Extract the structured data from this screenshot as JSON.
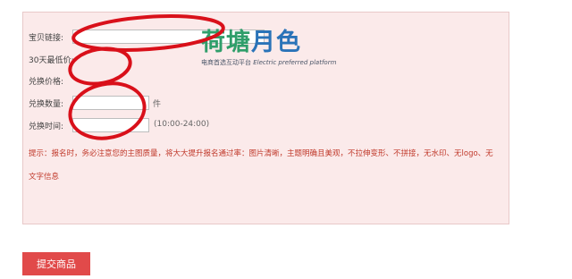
{
  "form": {
    "link_label": "宝贝链接:",
    "lowest_price_label": "30天最低价:",
    "exchange_price_label": "兑换价格:",
    "exchange_qty_label": "兑换数量:",
    "exchange_qty_unit": "件",
    "exchange_time_label": "兑换时间:",
    "exchange_time_suffix": "(10:00-24:00)",
    "hint_line1": "提示：报名时，务必注意您的主图质量，将大大提升报名通过率：图片清晰，主题明确且美观，不拉伸变形、不拼接，无水印、无logo、无",
    "hint_line2": "文字信息"
  },
  "logo": {
    "title_part1": "荷塘",
    "title_part2": "月色",
    "subtitle_cn": "电商首选互动平台",
    "subtitle_en": "Electric preferred platform"
  },
  "actions": {
    "submit_label": "提交商品"
  },
  "colors": {
    "panel_bg": "#fbeaea",
    "hint_text": "#c0392b",
    "submit_bg": "#e14a4a",
    "annotation_red": "#d9101a",
    "logo_green": "#2f9e6a",
    "logo_blue": "#2a73b8"
  }
}
